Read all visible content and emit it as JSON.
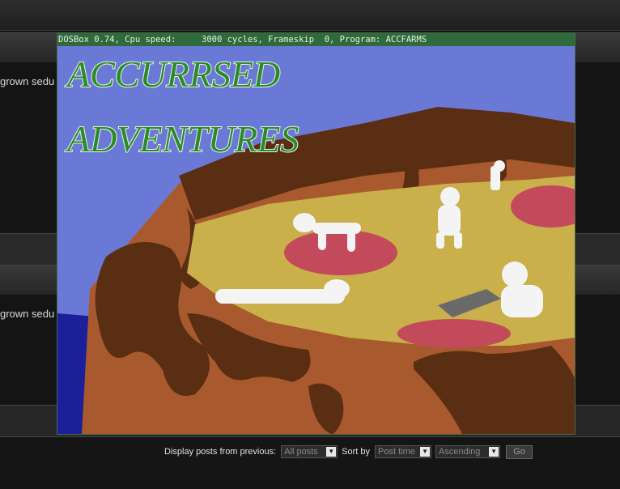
{
  "forum": {
    "snippet_1": "grown sedu",
    "snippet_2": "grown sedu"
  },
  "dosbox": {
    "title": "DOSBox 0.74, Cpu speed:     3000 cycles, Frameskip  0, Program: ACCFARMS",
    "game_title_line1": "ACCURRSED",
    "game_title_line2": "ADVENTURES"
  },
  "sortbar": {
    "display_label": "Display posts from previous:",
    "display_value": "All posts",
    "sort_label": "Sort by",
    "sort_value": "Post time",
    "order_value": "Ascending",
    "go_label": "Go"
  },
  "colors": {
    "sky": "#6b79d6",
    "sea": "#1c1f9a",
    "crust": "#a85a2e",
    "chocolate": "#5a2e12",
    "cheese": "#c9b04a",
    "pepperoni": "#c24a5a",
    "title_green": "#2a8a2a",
    "dos_titlebar": "#2f6a3b"
  }
}
